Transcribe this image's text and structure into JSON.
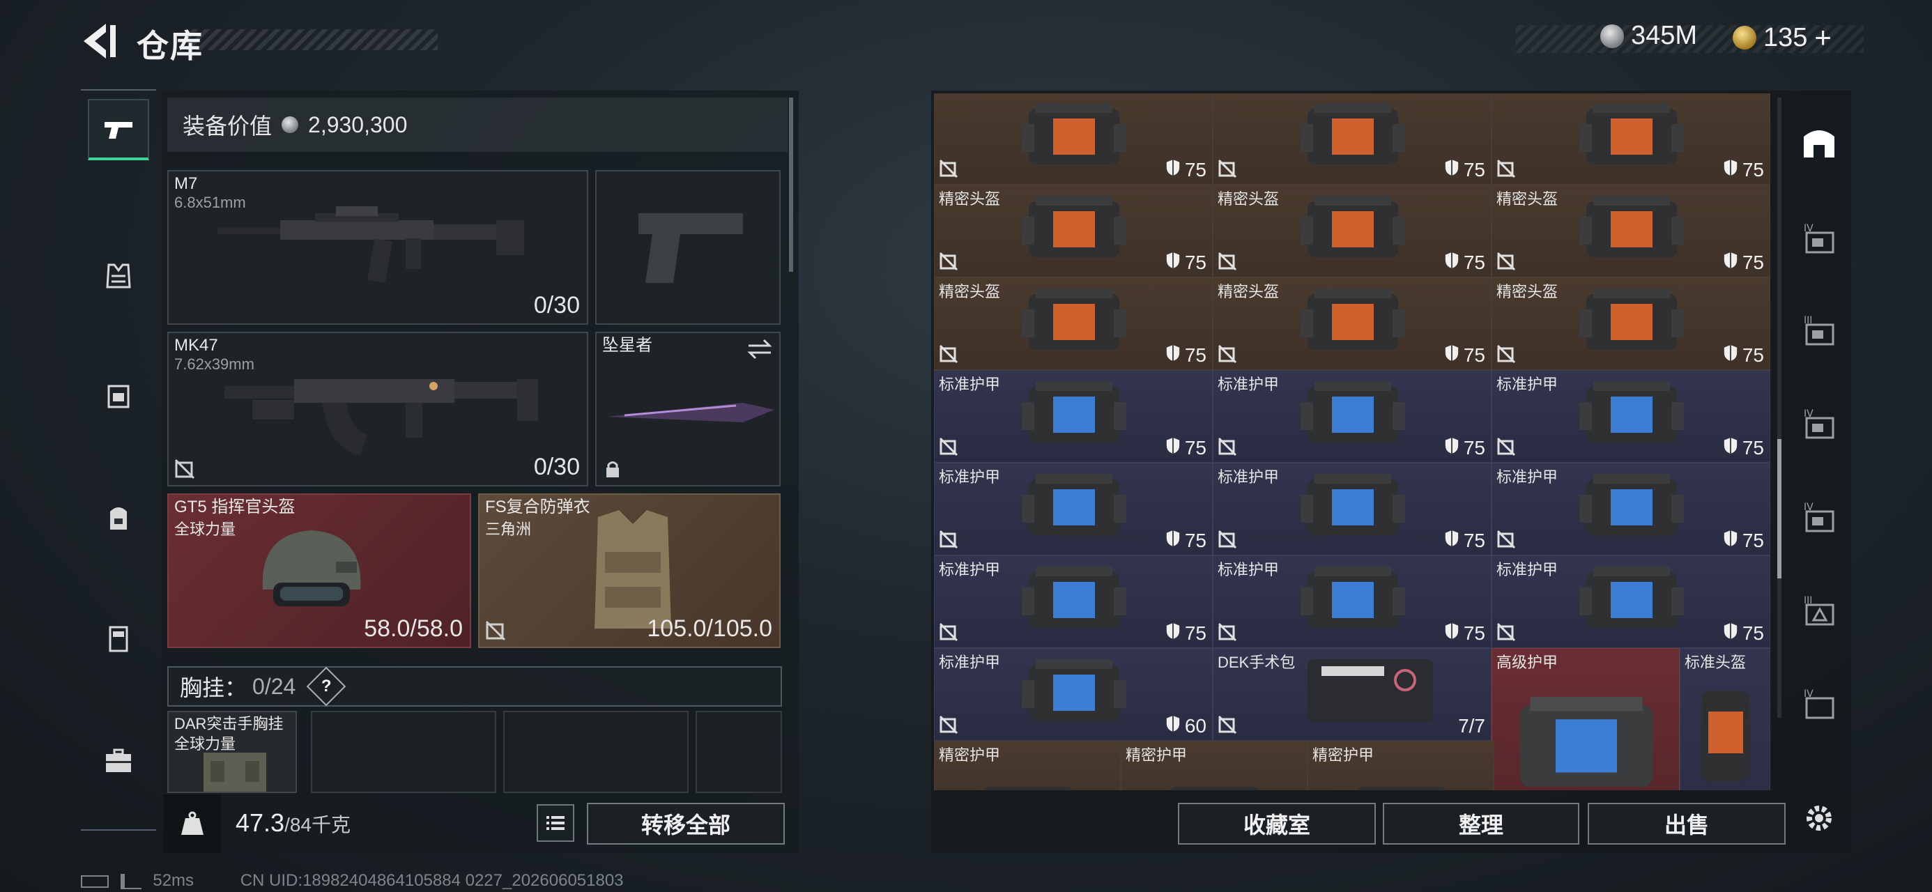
{
  "header": {
    "title": "仓库"
  },
  "currency": {
    "silver": "345M",
    "gold": "135",
    "gold_add": "+"
  },
  "left": {
    "equip_value_label": "装备价值",
    "equip_value": "2,930,300",
    "slots": {
      "primary": {
        "name": "M7",
        "caliber": "6.8x51mm",
        "ammo": "0/30"
      },
      "secondary": {
        "name": "MK47",
        "caliber": "7.62x39mm",
        "ammo": "0/30"
      },
      "melee": {
        "name": "坠星者"
      },
      "helmet": {
        "name": "GT5 指挥官头盔",
        "sub": "全球力量",
        "durability": "58.0/58.0"
      },
      "armor": {
        "name": "FS复合防弹衣",
        "sub": "三角洲",
        "durability": "105.0/105.0"
      }
    },
    "chest_rig": {
      "label": "胸挂：",
      "count": "0/24",
      "help": "?"
    },
    "rig_item": {
      "name": "DAR突击手胸挂",
      "sub": "全球力量"
    },
    "weight": {
      "value": "47.3",
      "max": "/84",
      "unit": "千克"
    },
    "transfer_all": "转移全部"
  },
  "right": {
    "cells_row0": [
      {
        "name": "",
        "dur": "75"
      },
      {
        "name": "",
        "dur": "75"
      },
      {
        "name": "",
        "dur": "75"
      }
    ],
    "cells_orange": [
      {
        "name": "精密头盔",
        "dur": "75"
      },
      {
        "name": "精密头盔",
        "dur": "75"
      },
      {
        "name": "精密头盔",
        "dur": "75"
      },
      {
        "name": "精密头盔",
        "dur": "75"
      },
      {
        "name": "精密头盔",
        "dur": "75"
      },
      {
        "name": "精密头盔",
        "dur": "75"
      }
    ],
    "cells_blue": [
      {
        "name": "标准护甲",
        "dur": "75"
      },
      {
        "name": "标准护甲",
        "dur": "75"
      },
      {
        "name": "标准护甲",
        "dur": "75"
      },
      {
        "name": "标准护甲",
        "dur": "75"
      },
      {
        "name": "标准护甲",
        "dur": "75"
      },
      {
        "name": "标准护甲",
        "dur": "75"
      },
      {
        "name": "标准护甲",
        "dur": "75"
      },
      {
        "name": "标准护甲",
        "dur": "75"
      },
      {
        "name": "标准护甲",
        "dur": "75"
      }
    ],
    "cell_armor_60": {
      "name": "标准护甲",
      "dur": "60"
    },
    "medkit": {
      "name": "DEK手术包",
      "count": "7/7"
    },
    "advanced_armor": {
      "name": "高级护甲"
    },
    "std_helmet": {
      "name": "标准头盔"
    },
    "precision_armor": [
      "精密护甲",
      "精密护甲",
      "精密护甲"
    ],
    "buttons": {
      "collection": "收藏室",
      "sort": "整理",
      "sell": "出售"
    }
  },
  "footer": {
    "ping": "52ms",
    "uid": "CN UID:18982404864105884 0227_202606051803"
  },
  "colors": {
    "accent": "#3fd19a",
    "orange_cell": "#4a3a2e",
    "blue_cell": "#33354f",
    "red_cell": "#6a2e33"
  }
}
